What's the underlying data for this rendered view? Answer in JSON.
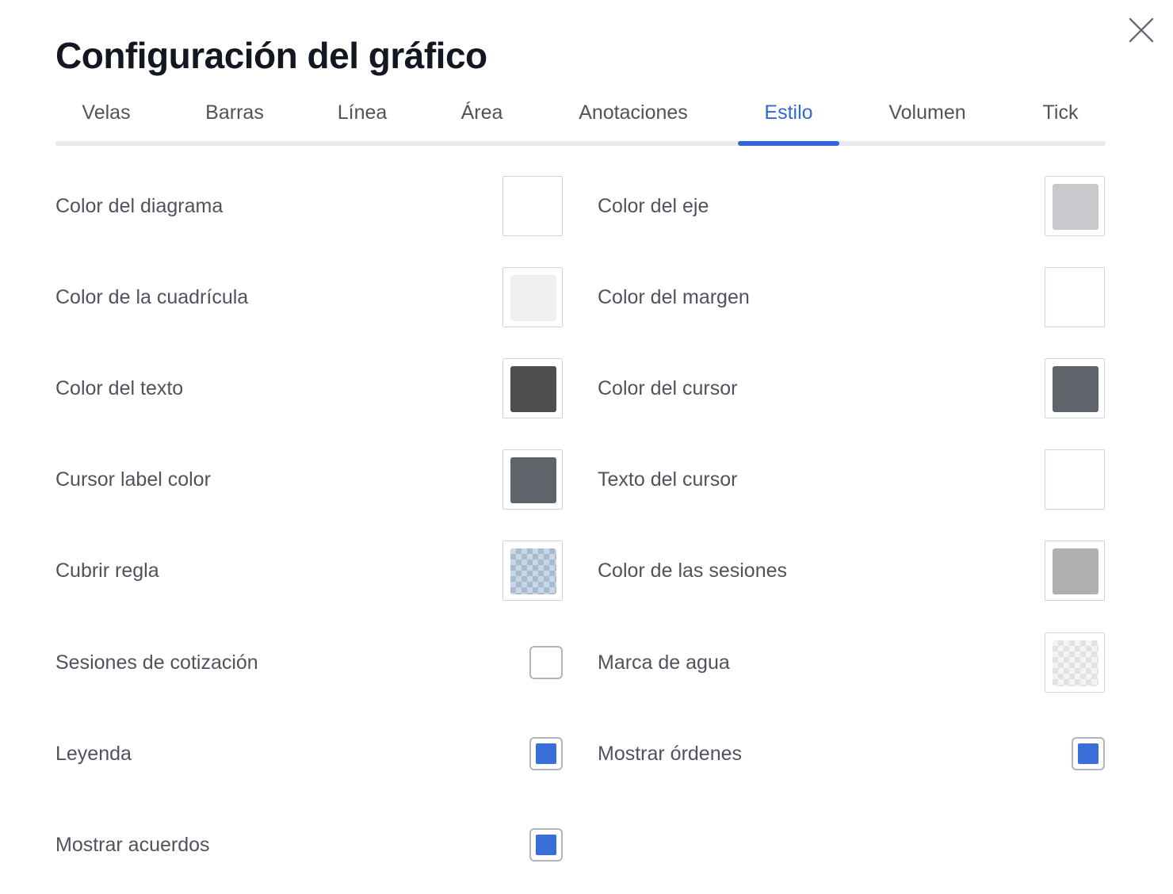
{
  "dialog": {
    "title": "Configuración del gráfico",
    "close_icon": "close-icon"
  },
  "tabs": [
    {
      "label": "Velas",
      "active": false
    },
    {
      "label": "Barras",
      "active": false
    },
    {
      "label": "Línea",
      "active": false
    },
    {
      "label": "Área",
      "active": false
    },
    {
      "label": "Anotaciones",
      "active": false
    },
    {
      "label": "Estilo",
      "active": true
    },
    {
      "label": "Volumen",
      "active": false
    },
    {
      "label": "Tick",
      "active": false
    }
  ],
  "accent_color": "#3467d6",
  "settings": {
    "left": [
      {
        "label": "Color del diagrama",
        "control": "color",
        "color": "#ffffff"
      },
      {
        "label": "Color de la cuadrícula",
        "control": "color",
        "color": "#f0f0f0"
      },
      {
        "label": "Color del texto",
        "control": "color",
        "color": "#4f4f4f"
      },
      {
        "label": "Cursor label color",
        "control": "color",
        "color": "#5f646b"
      },
      {
        "label": "Cubrir regla",
        "control": "color",
        "color": "transparent-blue"
      },
      {
        "label": "Sesiones de cotización",
        "control": "checkbox",
        "checked": false
      },
      {
        "label": "Leyenda",
        "control": "checkbox",
        "checked": true
      },
      {
        "label": "Mostrar acuerdos",
        "control": "checkbox",
        "checked": true
      }
    ],
    "right": [
      {
        "label": "Color del eje",
        "control": "color",
        "color": "#c8c9cc"
      },
      {
        "label": "Color del margen",
        "control": "color",
        "color": "#ffffff"
      },
      {
        "label": "Color del cursor",
        "control": "color",
        "color": "#5f646b"
      },
      {
        "label": "Texto del cursor",
        "control": "color",
        "color": "#ffffff"
      },
      {
        "label": "Color de las sesiones",
        "control": "color",
        "color": "#b0b0b0"
      },
      {
        "label": "Marca de agua",
        "control": "color",
        "color": "transparent-gray"
      },
      {
        "label": "Mostrar órdenes",
        "control": "checkbox",
        "checked": true
      }
    ]
  }
}
